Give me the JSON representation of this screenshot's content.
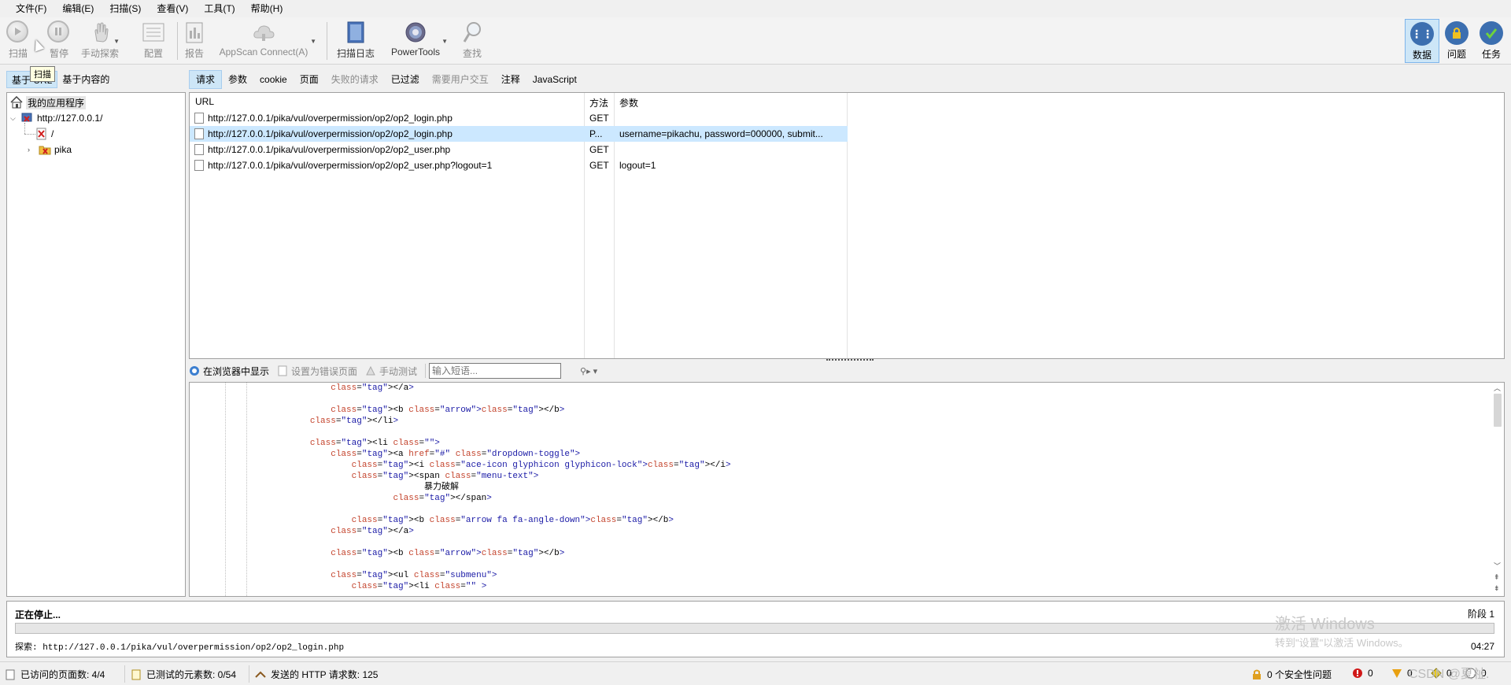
{
  "menu": [
    "文件(F)",
    "编辑(E)",
    "扫描(S)",
    "查看(V)",
    "工具(T)",
    "帮助(H)"
  ],
  "toolbar": {
    "scan": "扫描",
    "pause": "暂停",
    "manual_explore": "手动探索",
    "config": "配置",
    "report": "报告",
    "appscan_connect": "AppScan Connect(A)",
    "scan_log": "扫描日志",
    "powertools": "PowerTools",
    "find": "查找",
    "data": "数据",
    "issues": "问题",
    "tasks": "任务"
  },
  "tooltip": "扫描",
  "left_tabs": [
    "基于 URL",
    "基于内容的"
  ],
  "tree": {
    "root": "我的应用程序",
    "host": "http://127.0.0.1/",
    "slash": "/",
    "pika": "pika"
  },
  "right_tabs": [
    "请求",
    "参数",
    "cookie",
    "页面",
    "失败的请求",
    "已过滤",
    "需要用户交互",
    "注释",
    "JavaScript"
  ],
  "table": {
    "headers": {
      "url": "URL",
      "method": "方法",
      "params": "参数"
    },
    "rows": [
      {
        "url": "http://127.0.0.1/pika/vul/overpermission/op2/op2_login.php",
        "method": "GET",
        "params": ""
      },
      {
        "url": "http://127.0.0.1/pika/vul/overpermission/op2/op2_login.php",
        "method": "P...",
        "params": "username=pikachu, password=000000, submit..."
      },
      {
        "url": "http://127.0.0.1/pika/vul/overpermission/op2/op2_user.php",
        "method": "GET",
        "params": ""
      },
      {
        "url": "http://127.0.0.1/pika/vul/overpermission/op2/op2_user.php?logout=1",
        "method": "GET",
        "params": "logout=1"
      }
    ]
  },
  "response_toolbar": {
    "show_in_browser": "在浏览器中显示",
    "set_error_page": "设置为错误页面",
    "manual_test": "手动测试",
    "phrase_placeholder": "输入短语..."
  },
  "code_lines": [
    "            </a>",
    "",
    "            <b class=\"arrow\"></b>",
    "        </li>",
    "",
    "        <li class=\"\">",
    "            <a href=\"#\" class=\"dropdown-toggle\">",
    "                <i class=\"ace-icon glyphicon glyphicon-lock\"></i>",
    "                <span class=\"menu-text\">",
    "                              暴力破解",
    "                        </span>",
    "",
    "                <b class=\"arrow fa fa-angle-down\"></b>",
    "            </a>",
    "",
    "            <b class=\"arrow\"></b>",
    "",
    "            <ul class=\"submenu\">",
    "                <li class=\"\" >"
  ],
  "status": {
    "stopping": "正在停止...",
    "stage": "阶段 1",
    "progress_fraction": 0.0,
    "explore": "探索: http://127.0.0.1/pika/vul/overpermission/op2/op2_login.php",
    "elapsed": "04:27",
    "watermark_title": "激活 Windows",
    "watermark_sub": "转到\"设置\"以激活 Windows。"
  },
  "statusbar": {
    "visited": "已访问的页面数: 4/4",
    "tested": "已测试的元素数: 0/54",
    "sent": "发送的 HTTP 请求数: 125",
    "security_issues": "0 个安全性问题",
    "high": "0",
    "medium": "0",
    "low": "0",
    "info": "0",
    "csdn": "CSDN @夏祉."
  },
  "colors": {
    "accent_select": "#cde6f7",
    "row_select": "#cce8ff",
    "code_tag": "#1a1aa6",
    "code_attr": "#c4442d"
  }
}
